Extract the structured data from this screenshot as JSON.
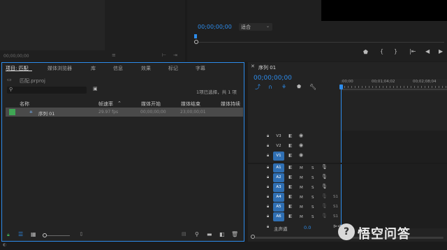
{
  "source": {
    "timecode": "00;00;00;00"
  },
  "program": {
    "timecode": "00;00;00;00",
    "fit": "适合"
  },
  "project": {
    "tabs": [
      "项目: 匹配",
      "媒体浏览器",
      "库",
      "信息",
      "效果",
      "标记",
      "字幕"
    ],
    "file": "匹配.prproj",
    "selection": "1项已选择，共 1 项",
    "columns": [
      "名称",
      "帧速率",
      "媒体开始",
      "媒体结束",
      "媒体持续"
    ],
    "item": {
      "name": "序列 01",
      "fps": "29.97 fps",
      "start": "00;00;00;00",
      "end": "23;00;00;01",
      "duration": ""
    }
  },
  "timeline": {
    "tab": "序列 01",
    "timecode": "00;00;00;00",
    "ruler": [
      ":00;00",
      "00;01;04;02",
      "00;02;08;04"
    ],
    "video_tracks": [
      "V3",
      "V2",
      "V1"
    ],
    "audio_tracks": [
      "A1",
      "A2",
      "A3",
      "A4",
      "A5",
      "A6"
    ],
    "m": "M",
    "s": "S",
    "s1": "S1",
    "master": {
      "label": "主声道",
      "value": "0.0"
    }
  },
  "watermark": {
    "text": "悟空问答"
  }
}
